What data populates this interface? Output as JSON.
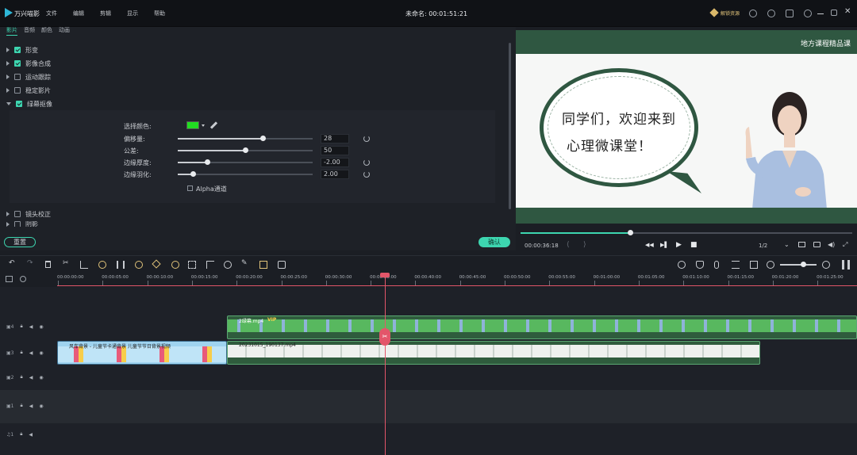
{
  "app": {
    "name": "万兴喵影",
    "title": "未命名: 00:01:51:21"
  },
  "menu": [
    "文件",
    "编辑",
    "剪辑",
    "显示",
    "帮助"
  ],
  "titlebar_right": {
    "unlock_label": "解锁资源"
  },
  "tabs": [
    "影片",
    "音频",
    "颜色",
    "动画"
  ],
  "sections": [
    {
      "label": "形变",
      "checked": true,
      "expanded": false
    },
    {
      "label": "影像合成",
      "checked": true,
      "expanded": false
    },
    {
      "label": "运动跟踪",
      "checked": false,
      "expanded": false
    },
    {
      "label": "稳定影片",
      "checked": false,
      "expanded": false
    },
    {
      "label": "绿幕抠像",
      "checked": true,
      "expanded": true
    },
    {
      "label": "镜头校正",
      "checked": false,
      "expanded": false
    },
    {
      "label": "阴影",
      "checked": false,
      "expanded": false
    }
  ],
  "chroma": {
    "color_label": "选择颜色:",
    "color": "#22dd22",
    "params": [
      {
        "label": "偏移量:",
        "value": "28",
        "level": 0.63,
        "reset": true
      },
      {
        "label": "公差:",
        "value": "50",
        "level": 0.5,
        "reset": false
      },
      {
        "label": "边缘厚度:",
        "value": "-2.00",
        "level": 0.22,
        "reset": true
      },
      {
        "label": "边缘羽化:",
        "value": "2.00",
        "level": 0.11,
        "reset": true
      }
    ],
    "alpha_label": "Alpha通道"
  },
  "buttons": {
    "reset": "重置",
    "ok": "确认"
  },
  "preview": {
    "slide_header": "地方课程精品课",
    "bubble_line1": "同学们，欢迎来到",
    "bubble_line2": "心理微课堂！",
    "timecode": "00:00:36:18",
    "progress": 0.33,
    "quality": "1/2"
  },
  "ruler": [
    "00:00:00:00",
    "00:00:05:00",
    "00:00:10:00",
    "00:00:15:00",
    "00:00:20:00",
    "00:00:25:00",
    "00:00:30:00",
    "00:00:35:00",
    "00:00:40:00",
    "00:00:45:00",
    "00:00:50:00",
    "00:00:55:00",
    "00:01:00:00",
    "00:01:05:00",
    "00:01:10:00",
    "00:01:15:00",
    "00:01:20:00",
    "00:01:25:00"
  ],
  "tracks": [
    {
      "label": "4"
    },
    {
      "label": "3"
    },
    {
      "label": "2"
    },
    {
      "label": "1"
    },
    {
      "label": "1"
    }
  ],
  "clips": {
    "green": {
      "name": "2绿幕.mp4",
      "badge": "VIP"
    },
    "pattern": {
      "name": "风车背景 - 儿童节卡通背景 儿童节节日背景视频"
    },
    "slide": {
      "name": "20231015_190137.mp4"
    }
  }
}
